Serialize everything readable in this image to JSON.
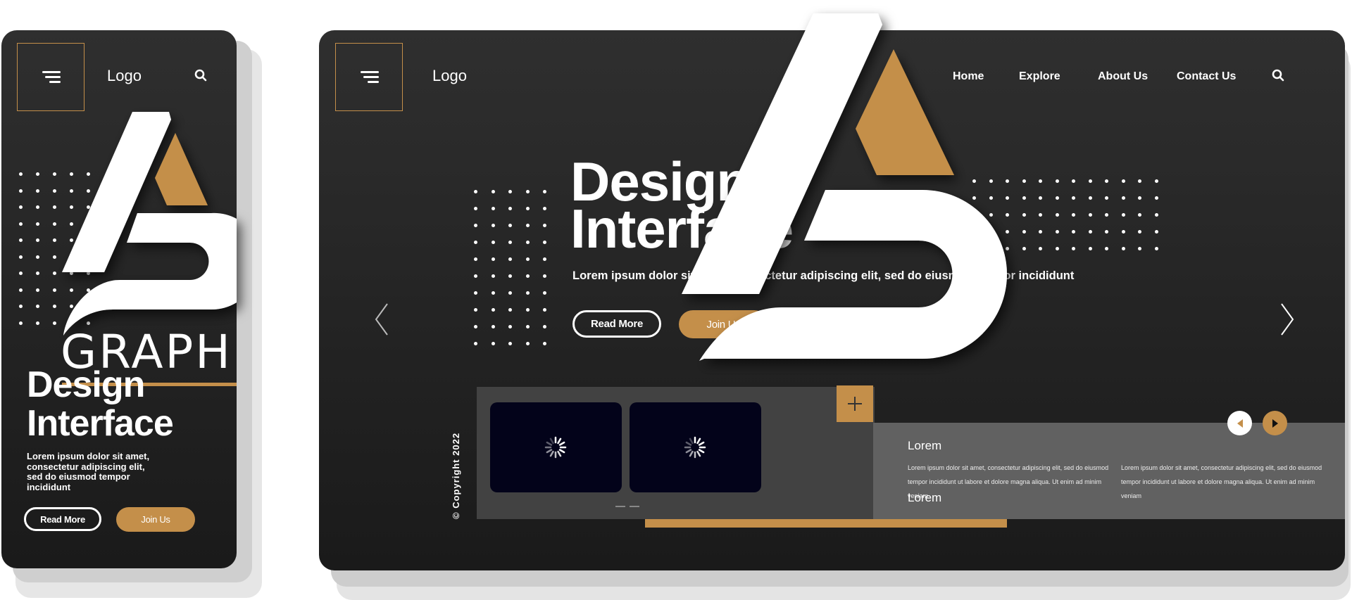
{
  "mobile": {
    "logo": "Logo",
    "brand_word": "GRAPH",
    "title_line1": "Design",
    "title_line2": "Interface",
    "description": "Lorem ipsum dolor sit amet, consectetur adipiscing elit, sed do eiusmod tempor incididunt",
    "read_more": "Read More",
    "join_us": "Join Us"
  },
  "desktop": {
    "logo": "Logo",
    "nav": [
      "Home",
      "Explore",
      "About Us",
      "Contact Us"
    ],
    "title_line1": "Design",
    "title_line2": "Interface",
    "description": "Lorem ipsum dolor sit amet, consectetur adipiscing elit, sed do eiusmod tempor incididunt",
    "read_more": "Read More",
    "join_us": "Join Us",
    "copyright": "© Copyright 2022",
    "info": {
      "heading1": "Lorem",
      "col1": "Lorem ipsum dolor sit amet, consectetur adipiscing elit, sed do eiusmod tempor incididunt ut labore et dolore magna aliqua. Ut enim ad minim veniam",
      "col2": "Lorem ipsum dolor sit amet, consectetur adipiscing elit, sed do eiusmod tempor incididunt ut labore et dolore magna aliqua. Ut enim ad minim veniam",
      "heading2": "Lorem"
    }
  },
  "colors": {
    "accent": "#c48f4a",
    "background": "#2a2a2a",
    "panel": "#424242",
    "info_panel": "#616161",
    "video": "#03031a"
  },
  "icons": [
    "menu-icon",
    "search-icon",
    "chevron-left-icon",
    "chevron-right-icon",
    "plus-icon",
    "spinner-icon",
    "triangle-left-icon",
    "triangle-right-icon"
  ]
}
